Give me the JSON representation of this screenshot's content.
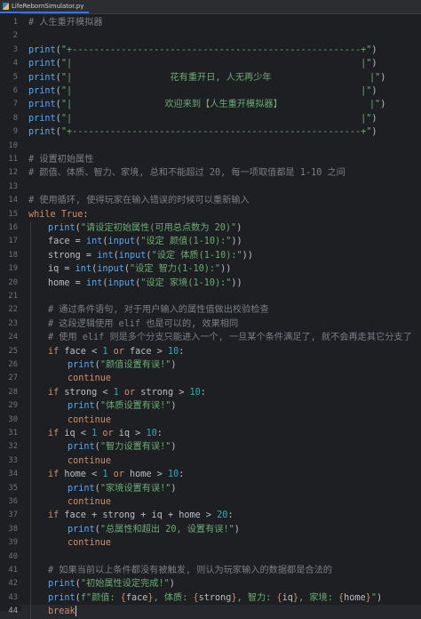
{
  "tab": {
    "label": "LifeRebornSimulator.py",
    "icon": "python-file-icon"
  },
  "colors": {
    "background": "#1e1f22",
    "keyword": "#cf8e6d",
    "function": "#56a8f5",
    "string": "#6aab73",
    "number": "#2aacb8",
    "comment": "#7a7e85",
    "text": "#bcbec4"
  },
  "caret_line": 44,
  "lines": [
    {
      "n": "1",
      "i": 0,
      "tokens": [
        [
          "c",
          "# 人生重开模拟器"
        ]
      ]
    },
    {
      "n": "2",
      "i": 0,
      "tokens": []
    },
    {
      "n": "3",
      "i": 0,
      "tokens": [
        [
          "f",
          "print"
        ],
        [
          "t",
          "("
        ],
        [
          "s",
          "\"+-----------------------------------------------------+\""
        ],
        [
          "t",
          ")"
        ]
      ]
    },
    {
      "n": "4",
      "i": 0,
      "tokens": [
        [
          "f",
          "print"
        ],
        [
          "t",
          "("
        ],
        [
          "s",
          "\"|                                                     |\""
        ],
        [
          "t",
          ")"
        ]
      ]
    },
    {
      "n": "5",
      "i": 0,
      "tokens": [
        [
          "f",
          "print"
        ],
        [
          "t",
          "("
        ],
        [
          "s",
          "\"|                  花有重开日, 人无再少年                  |\""
        ],
        [
          "t",
          ")"
        ]
      ]
    },
    {
      "n": "6",
      "i": 0,
      "tokens": [
        [
          "f",
          "print"
        ],
        [
          "t",
          "("
        ],
        [
          "s",
          "\"|                                                     |\""
        ],
        [
          "t",
          ")"
        ]
      ]
    },
    {
      "n": "7",
      "i": 0,
      "tokens": [
        [
          "f",
          "print"
        ],
        [
          "t",
          "("
        ],
        [
          "s",
          "\"|                 欢迎来到【人生重开模拟器】                |\""
        ],
        [
          "t",
          ")"
        ]
      ]
    },
    {
      "n": "8",
      "i": 0,
      "tokens": [
        [
          "f",
          "print"
        ],
        [
          "t",
          "("
        ],
        [
          "s",
          "\"|                                                     |\""
        ],
        [
          "t",
          ")"
        ]
      ]
    },
    {
      "n": "9",
      "i": 0,
      "tokens": [
        [
          "f",
          "print"
        ],
        [
          "t",
          "("
        ],
        [
          "s",
          "\"+-----------------------------------------------------+\""
        ],
        [
          "t",
          ")"
        ]
      ]
    },
    {
      "n": "10",
      "i": 0,
      "tokens": []
    },
    {
      "n": "11",
      "i": 0,
      "tokens": [
        [
          "c",
          "# 设置初始属性"
        ]
      ]
    },
    {
      "n": "12",
      "i": 0,
      "tokens": [
        [
          "c",
          "# 颜值、体质、智力、家境, 总和不能超过 20, 每一项取值都是 1-10 之间"
        ]
      ]
    },
    {
      "n": "13",
      "i": 0,
      "tokens": []
    },
    {
      "n": "14",
      "i": 0,
      "tokens": [
        [
          "c",
          "# 使用循环, 使得玩家在输入错误的时候可以重新输入"
        ]
      ]
    },
    {
      "n": "15",
      "i": 0,
      "tokens": [
        [
          "k",
          "while "
        ],
        [
          "k",
          "True"
        ],
        [
          "t",
          ":"
        ]
      ]
    },
    {
      "n": "16",
      "i": 1,
      "tokens": [
        [
          "f",
          "print"
        ],
        [
          "t",
          "("
        ],
        [
          "s",
          "\"请设定初始属性(可用总点数为 20)\""
        ],
        [
          "t",
          ")"
        ]
      ]
    },
    {
      "n": "17",
      "i": 1,
      "tokens": [
        [
          "t",
          "face = "
        ],
        [
          "f",
          "int"
        ],
        [
          "t",
          "("
        ],
        [
          "f",
          "input"
        ],
        [
          "t",
          "("
        ],
        [
          "s",
          "\"设定 颜值(1-10):\""
        ],
        [
          "t",
          "))"
        ]
      ]
    },
    {
      "n": "18",
      "i": 1,
      "tokens": [
        [
          "t",
          "strong = "
        ],
        [
          "f",
          "int"
        ],
        [
          "t",
          "("
        ],
        [
          "f",
          "input"
        ],
        [
          "t",
          "("
        ],
        [
          "s",
          "\"设定 体质(1-10):\""
        ],
        [
          "t",
          "))"
        ]
      ]
    },
    {
      "n": "19",
      "i": 1,
      "tokens": [
        [
          "t",
          "iq = "
        ],
        [
          "f",
          "int"
        ],
        [
          "t",
          "("
        ],
        [
          "f",
          "input"
        ],
        [
          "t",
          "("
        ],
        [
          "s",
          "\"设定 智力(1-10):\""
        ],
        [
          "t",
          "))"
        ]
      ]
    },
    {
      "n": "20",
      "i": 1,
      "tokens": [
        [
          "t",
          "home = "
        ],
        [
          "f",
          "int"
        ],
        [
          "t",
          "("
        ],
        [
          "f",
          "input"
        ],
        [
          "t",
          "("
        ],
        [
          "s",
          "\"设定 家境(1-10):\""
        ],
        [
          "t",
          "))"
        ]
      ]
    },
    {
      "n": "21",
      "i": 0,
      "tokens": []
    },
    {
      "n": "22",
      "i": 1,
      "tokens": [
        [
          "c",
          "# 通过条件语句, 对于用户输入的属性值做出校验检查"
        ]
      ]
    },
    {
      "n": "23",
      "i": 1,
      "tokens": [
        [
          "c",
          "# 这段逻辑使用 elif 也是可以的, 效果相同"
        ]
      ]
    },
    {
      "n": "24",
      "i": 1,
      "tokens": [
        [
          "c",
          "# 使用 elif 则是多个分支只能进入一个, 一旦某个条件满足了, 就不会再走其它分支了"
        ]
      ]
    },
    {
      "n": "25",
      "i": 1,
      "tokens": [
        [
          "k",
          "if "
        ],
        [
          "t",
          "face < "
        ],
        [
          "n",
          "1"
        ],
        [
          "k",
          " or "
        ],
        [
          "t",
          "face > "
        ],
        [
          "n",
          "10"
        ],
        [
          "t",
          ":"
        ]
      ]
    },
    {
      "n": "26",
      "i": 2,
      "tokens": [
        [
          "f",
          "print"
        ],
        [
          "t",
          "("
        ],
        [
          "s",
          "\"颜值设置有误!\""
        ],
        [
          "t",
          ")"
        ]
      ]
    },
    {
      "n": "27",
      "i": 2,
      "tokens": [
        [
          "k",
          "continue"
        ]
      ]
    },
    {
      "n": "28",
      "i": 1,
      "tokens": [
        [
          "k",
          "if "
        ],
        [
          "t",
          "strong < "
        ],
        [
          "n",
          "1"
        ],
        [
          "k",
          " or "
        ],
        [
          "t",
          "strong > "
        ],
        [
          "n",
          "10"
        ],
        [
          "t",
          ":"
        ]
      ]
    },
    {
      "n": "29",
      "i": 2,
      "tokens": [
        [
          "f",
          "print"
        ],
        [
          "t",
          "("
        ],
        [
          "s",
          "\"体质设置有误!\""
        ],
        [
          "t",
          ")"
        ]
      ]
    },
    {
      "n": "30",
      "i": 2,
      "tokens": [
        [
          "k",
          "continue"
        ]
      ]
    },
    {
      "n": "31",
      "i": 1,
      "tokens": [
        [
          "k",
          "if "
        ],
        [
          "t",
          "iq < "
        ],
        [
          "n",
          "1"
        ],
        [
          "k",
          " or "
        ],
        [
          "t",
          "iq > "
        ],
        [
          "n",
          "10"
        ],
        [
          "t",
          ":"
        ]
      ]
    },
    {
      "n": "32",
      "i": 2,
      "tokens": [
        [
          "f",
          "print"
        ],
        [
          "t",
          "("
        ],
        [
          "s",
          "\"智力设置有误!\""
        ],
        [
          "t",
          ")"
        ]
      ]
    },
    {
      "n": "33",
      "i": 2,
      "tokens": [
        [
          "k",
          "continue"
        ]
      ]
    },
    {
      "n": "34",
      "i": 1,
      "tokens": [
        [
          "k",
          "if "
        ],
        [
          "t",
          "home < "
        ],
        [
          "n",
          "1"
        ],
        [
          "k",
          " or "
        ],
        [
          "t",
          "home > "
        ],
        [
          "n",
          "10"
        ],
        [
          "t",
          ":"
        ]
      ]
    },
    {
      "n": "35",
      "i": 2,
      "tokens": [
        [
          "f",
          "print"
        ],
        [
          "t",
          "("
        ],
        [
          "s",
          "\"家境设置有误!\""
        ],
        [
          "t",
          ")"
        ]
      ]
    },
    {
      "n": "36",
      "i": 2,
      "tokens": [
        [
          "k",
          "continue"
        ]
      ]
    },
    {
      "n": "37",
      "i": 1,
      "tokens": [
        [
          "k",
          "if "
        ],
        [
          "t",
          "face + strong + iq + home > "
        ],
        [
          "n",
          "20"
        ],
        [
          "t",
          ":"
        ]
      ]
    },
    {
      "n": "38",
      "i": 2,
      "tokens": [
        [
          "f",
          "print"
        ],
        [
          "t",
          "("
        ],
        [
          "s",
          "\"总属性和超出 20, 设置有误!\""
        ],
        [
          "t",
          ")"
        ]
      ]
    },
    {
      "n": "39",
      "i": 2,
      "tokens": [
        [
          "k",
          "continue"
        ]
      ]
    },
    {
      "n": "40",
      "i": 0,
      "tokens": []
    },
    {
      "n": "41",
      "i": 1,
      "tokens": [
        [
          "c",
          "# 如果当前以上条件都没有被触发, 则认为玩家输入的数据都是合法的"
        ]
      ]
    },
    {
      "n": "42",
      "i": 1,
      "tokens": [
        [
          "f",
          "print"
        ],
        [
          "t",
          "("
        ],
        [
          "s",
          "\"初始属性设定完成!\""
        ],
        [
          "t",
          ")"
        ]
      ]
    },
    {
      "n": "43",
      "i": 1,
      "tokens": [
        [
          "f",
          "print"
        ],
        [
          "t",
          "("
        ],
        [
          "s",
          "f\"颜值: "
        ],
        [
          "k",
          "{"
        ],
        [
          "t",
          "face"
        ],
        [
          "k",
          "}"
        ],
        [
          "s",
          ", 体质: "
        ],
        [
          "k",
          "{"
        ],
        [
          "t",
          "strong"
        ],
        [
          "k",
          "}"
        ],
        [
          "s",
          ", 智力: "
        ],
        [
          "k",
          "{"
        ],
        [
          "t",
          "iq"
        ],
        [
          "k",
          "}"
        ],
        [
          "s",
          ", 家境: "
        ],
        [
          "k",
          "{"
        ],
        [
          "t",
          "home"
        ],
        [
          "k",
          "}"
        ],
        [
          "s",
          "\""
        ],
        [
          "t",
          ")"
        ]
      ]
    },
    {
      "n": "44",
      "i": 1,
      "tokens": [
        [
          "k",
          "break"
        ]
      ]
    }
  ]
}
